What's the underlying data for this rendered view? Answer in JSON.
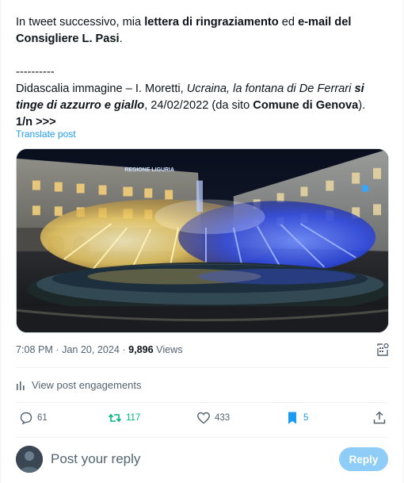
{
  "tweet": {
    "line1_pre": "In tweet successivo, mia ",
    "line1_bold": "lettera di ringraziamento",
    "line1_mid": " ed ",
    "line1_bold2": "e-mail del Consigliere L. Pasi",
    "line1_end": ".",
    "separator": "----------",
    "caption_pre": "Didascalia immagine – I. Moretti, ",
    "caption_italic": "Ucraina, la fontana di De Ferrari ",
    "caption_bolditalic": "si tinge di azzurro e giallo",
    "caption_mid": ", 24/02/2022 (da sito ",
    "caption_bold": "Comune di Genova",
    "caption_end": ").",
    "counter": "1/n >>>",
    "translate_label": "Translate post"
  },
  "media": {
    "building_sign": "REGIONE LIGURIA"
  },
  "meta": {
    "time": "7:08 PM",
    "separator": " · ",
    "date": "Jan 20, 2024",
    "views_count": "9,896",
    "views_label": " Views"
  },
  "engagements_label": "View post engagements",
  "actions": {
    "replies": "61",
    "reposts": "117",
    "likes": "433",
    "bookmarks": "5"
  },
  "reply": {
    "placeholder": "Post your reply",
    "button_label": "Reply"
  },
  "colors": {
    "accent": "#1d9bf0",
    "repost_active": "#00ba7c",
    "muted": "#536471"
  }
}
